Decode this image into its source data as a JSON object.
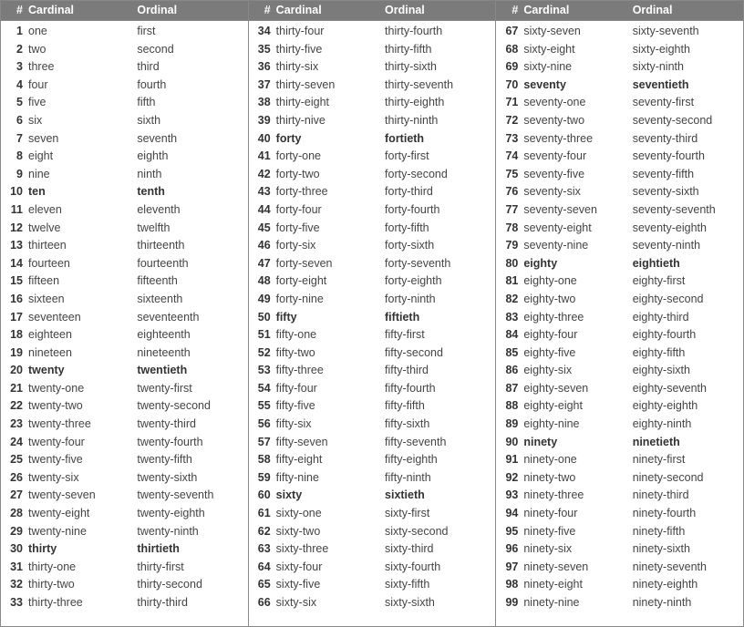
{
  "headers": {
    "num": "#",
    "cardinal": "Cardinal",
    "ordinal": "Ordinal"
  },
  "columns": [
    {
      "rows": [
        {
          "n": "1",
          "c": "one",
          "o": "first",
          "b": false
        },
        {
          "n": "2",
          "c": "two",
          "o": "second",
          "b": false
        },
        {
          "n": "3",
          "c": "three",
          "o": "third",
          "b": false
        },
        {
          "n": "4",
          "c": "four",
          "o": "fourth",
          "b": false
        },
        {
          "n": "5",
          "c": "five",
          "o": "fifth",
          "b": false
        },
        {
          "n": "6",
          "c": "six",
          "o": "sixth",
          "b": false
        },
        {
          "n": "7",
          "c": "seven",
          "o": "seventh",
          "b": false
        },
        {
          "n": "8",
          "c": "eight",
          "o": "eighth",
          "b": false
        },
        {
          "n": "9",
          "c": "nine",
          "o": "ninth",
          "b": false
        },
        {
          "n": "10",
          "c": "ten",
          "o": "tenth",
          "b": true
        },
        {
          "n": "11",
          "c": "eleven",
          "o": "eleventh",
          "b": false
        },
        {
          "n": "12",
          "c": "twelve",
          "o": "twelfth",
          "b": false
        },
        {
          "n": "13",
          "c": "thirteen",
          "o": "thirteenth",
          "b": false
        },
        {
          "n": "14",
          "c": "fourteen",
          "o": "fourteenth",
          "b": false
        },
        {
          "n": "15",
          "c": "fifteen",
          "o": "fifteenth",
          "b": false
        },
        {
          "n": "16",
          "c": "sixteen",
          "o": "sixteenth",
          "b": false
        },
        {
          "n": "17",
          "c": "seventeen",
          "o": "seventeenth",
          "b": false
        },
        {
          "n": "18",
          "c": "eighteen",
          "o": "eighteenth",
          "b": false
        },
        {
          "n": "19",
          "c": "nineteen",
          "o": "nineteenth",
          "b": false
        },
        {
          "n": "20",
          "c": "twenty",
          "o": "twentieth",
          "b": true
        },
        {
          "n": "21",
          "c": "twenty-one",
          "o": "twenty-first",
          "b": false
        },
        {
          "n": "22",
          "c": "twenty-two",
          "o": "twenty-second",
          "b": false
        },
        {
          "n": "23",
          "c": "twenty-three",
          "o": "twenty-third",
          "b": false
        },
        {
          "n": "24",
          "c": "twenty-four",
          "o": "twenty-fourth",
          "b": false
        },
        {
          "n": "25",
          "c": "twenty-five",
          "o": "twenty-fifth",
          "b": false
        },
        {
          "n": "26",
          "c": "twenty-six",
          "o": "twenty-sixth",
          "b": false
        },
        {
          "n": "27",
          "c": "twenty-seven",
          "o": "twenty-seventh",
          "b": false
        },
        {
          "n": "28",
          "c": "twenty-eight",
          "o": "twenty-eighth",
          "b": false
        },
        {
          "n": "29",
          "c": "twenty-nine",
          "o": "twenty-ninth",
          "b": false
        },
        {
          "n": "30",
          "c": "thirty",
          "o": "thirtieth",
          "b": true
        },
        {
          "n": "31",
          "c": "thirty-one",
          "o": "thirty-first",
          "b": false
        },
        {
          "n": "32",
          "c": "thirty-two",
          "o": "thirty-second",
          "b": false
        },
        {
          "n": "33",
          "c": "thirty-three",
          "o": "thirty-third",
          "b": false
        }
      ]
    },
    {
      "rows": [
        {
          "n": "34",
          "c": "thirty-four",
          "o": "thirty-fourth",
          "b": false
        },
        {
          "n": "35",
          "c": "thirty-five",
          "o": "thirty-fifth",
          "b": false
        },
        {
          "n": "36",
          "c": "thirty-six",
          "o": "thirty-sixth",
          "b": false
        },
        {
          "n": "37",
          "c": "thirty-seven",
          "o": "thirty-seventh",
          "b": false
        },
        {
          "n": "38",
          "c": "thirty-eight",
          "o": "thirty-eighth",
          "b": false
        },
        {
          "n": "39",
          "c": "thirty-nive",
          "o": "thirty-ninth",
          "b": false
        },
        {
          "n": "40",
          "c": "forty",
          "o": "fortieth",
          "b": true
        },
        {
          "n": "41",
          "c": "forty-one",
          "o": "forty-first",
          "b": false
        },
        {
          "n": "42",
          "c": "forty-two",
          "o": "forty-second",
          "b": false
        },
        {
          "n": "43",
          "c": "forty-three",
          "o": "forty-third",
          "b": false
        },
        {
          "n": "44",
          "c": "forty-four",
          "o": "forty-fourth",
          "b": false
        },
        {
          "n": "45",
          "c": "forty-five",
          "o": "forty-fifth",
          "b": false
        },
        {
          "n": "46",
          "c": "forty-six",
          "o": "forty-sixth",
          "b": false
        },
        {
          "n": "47",
          "c": "forty-seven",
          "o": "forty-seventh",
          "b": false
        },
        {
          "n": "48",
          "c": "forty-eight",
          "o": "forty-eighth",
          "b": false
        },
        {
          "n": "49",
          "c": "forty-nine",
          "o": "forty-ninth",
          "b": false
        },
        {
          "n": "50",
          "c": "fifty",
          "o": "fiftieth",
          "b": true
        },
        {
          "n": "51",
          "c": "fifty-one",
          "o": "fifty-first",
          "b": false
        },
        {
          "n": "52",
          "c": "fifty-two",
          "o": "fifty-second",
          "b": false
        },
        {
          "n": "53",
          "c": "fifty-three",
          "o": "fifty-third",
          "b": false
        },
        {
          "n": "54",
          "c": "fifty-four",
          "o": "fifty-fourth",
          "b": false
        },
        {
          "n": "55",
          "c": "fifty-five",
          "o": "fifty-fifth",
          "b": false
        },
        {
          "n": "56",
          "c": "fifty-six",
          "o": "fifty-sixth",
          "b": false
        },
        {
          "n": "57",
          "c": "fifty-seven",
          "o": "fifty-seventh",
          "b": false
        },
        {
          "n": "58",
          "c": "fifty-eight",
          "o": "fifty-eighth",
          "b": false
        },
        {
          "n": "59",
          "c": "fifty-nine",
          "o": "fifty-ninth",
          "b": false
        },
        {
          "n": "60",
          "c": "sixty",
          "o": "sixtieth",
          "b": true
        },
        {
          "n": "61",
          "c": "sixty-one",
          "o": "sixty-first",
          "b": false
        },
        {
          "n": "62",
          "c": "sixty-two",
          "o": "sixty-second",
          "b": false
        },
        {
          "n": "63",
          "c": "sixty-three",
          "o": "sixty-third",
          "b": false
        },
        {
          "n": "64",
          "c": "sixty-four",
          "o": "sixty-fourth",
          "b": false
        },
        {
          "n": "65",
          "c": "sixty-five",
          "o": "sixty-fifth",
          "b": false
        },
        {
          "n": "66",
          "c": "sixty-six",
          "o": "sixty-sixth",
          "b": false
        }
      ]
    },
    {
      "rows": [
        {
          "n": "67",
          "c": "sixty-seven",
          "o": "sixty-seventh",
          "b": false
        },
        {
          "n": "68",
          "c": "sixty-eight",
          "o": "sixty-eighth",
          "b": false
        },
        {
          "n": "69",
          "c": "sixty-nine",
          "o": "sixty-ninth",
          "b": false
        },
        {
          "n": "70",
          "c": "seventy",
          "o": "seventieth",
          "b": true
        },
        {
          "n": "71",
          "c": "seventy-one",
          "o": "seventy-first",
          "b": false
        },
        {
          "n": "72",
          "c": "seventy-two",
          "o": "seventy-second",
          "b": false
        },
        {
          "n": "73",
          "c": "seventy-three",
          "o": "seventy-third",
          "b": false
        },
        {
          "n": "74",
          "c": "seventy-four",
          "o": "seventy-fourth",
          "b": false
        },
        {
          "n": "75",
          "c": "seventy-five",
          "o": "seventy-fifth",
          "b": false
        },
        {
          "n": "76",
          "c": "seventy-six",
          "o": "seventy-sixth",
          "b": false
        },
        {
          "n": "77",
          "c": "seventy-seven",
          "o": "seventy-seventh",
          "b": false
        },
        {
          "n": "78",
          "c": "seventy-eight",
          "o": "seventy-eighth",
          "b": false
        },
        {
          "n": "79",
          "c": "seventy-nine",
          "o": "seventy-ninth",
          "b": false
        },
        {
          "n": "80",
          "c": "eighty",
          "o": "eightieth",
          "b": true
        },
        {
          "n": "81",
          "c": "eighty-one",
          "o": "eighty-first",
          "b": false
        },
        {
          "n": "82",
          "c": "eighty-two",
          "o": "eighty-second",
          "b": false
        },
        {
          "n": "83",
          "c": "eighty-three",
          "o": "eighty-third",
          "b": false
        },
        {
          "n": "84",
          "c": "eighty-four",
          "o": "eighty-fourth",
          "b": false
        },
        {
          "n": "85",
          "c": "eighty-five",
          "o": "eighty-fifth",
          "b": false
        },
        {
          "n": "86",
          "c": "eighty-six",
          "o": "eighty-sixth",
          "b": false
        },
        {
          "n": "87",
          "c": "eighty-seven",
          "o": "eighty-seventh",
          "b": false
        },
        {
          "n": "88",
          "c": "eighty-eight",
          "o": "eighty-eighth",
          "b": false
        },
        {
          "n": "89",
          "c": "eighty-nine",
          "o": "eighty-ninth",
          "b": false
        },
        {
          "n": "90",
          "c": "ninety",
          "o": "ninetieth",
          "b": true
        },
        {
          "n": "91",
          "c": "ninety-one",
          "o": "ninety-first",
          "b": false
        },
        {
          "n": "92",
          "c": "ninety-two",
          "o": "ninety-second",
          "b": false
        },
        {
          "n": "93",
          "c": "ninety-three",
          "o": "ninety-third",
          "b": false
        },
        {
          "n": "94",
          "c": "ninety-four",
          "o": "ninety-fourth",
          "b": false
        },
        {
          "n": "95",
          "c": "ninety-five",
          "o": "ninety-fifth",
          "b": false
        },
        {
          "n": "96",
          "c": "ninety-six",
          "o": "ninety-sixth",
          "b": false
        },
        {
          "n": "97",
          "c": "ninety-seven",
          "o": "ninety-seventh",
          "b": false
        },
        {
          "n": "98",
          "c": "ninety-eight",
          "o": "ninety-eighth",
          "b": false
        },
        {
          "n": "99",
          "c": "ninety-nine",
          "o": "ninety-ninth",
          "b": false
        }
      ]
    }
  ]
}
